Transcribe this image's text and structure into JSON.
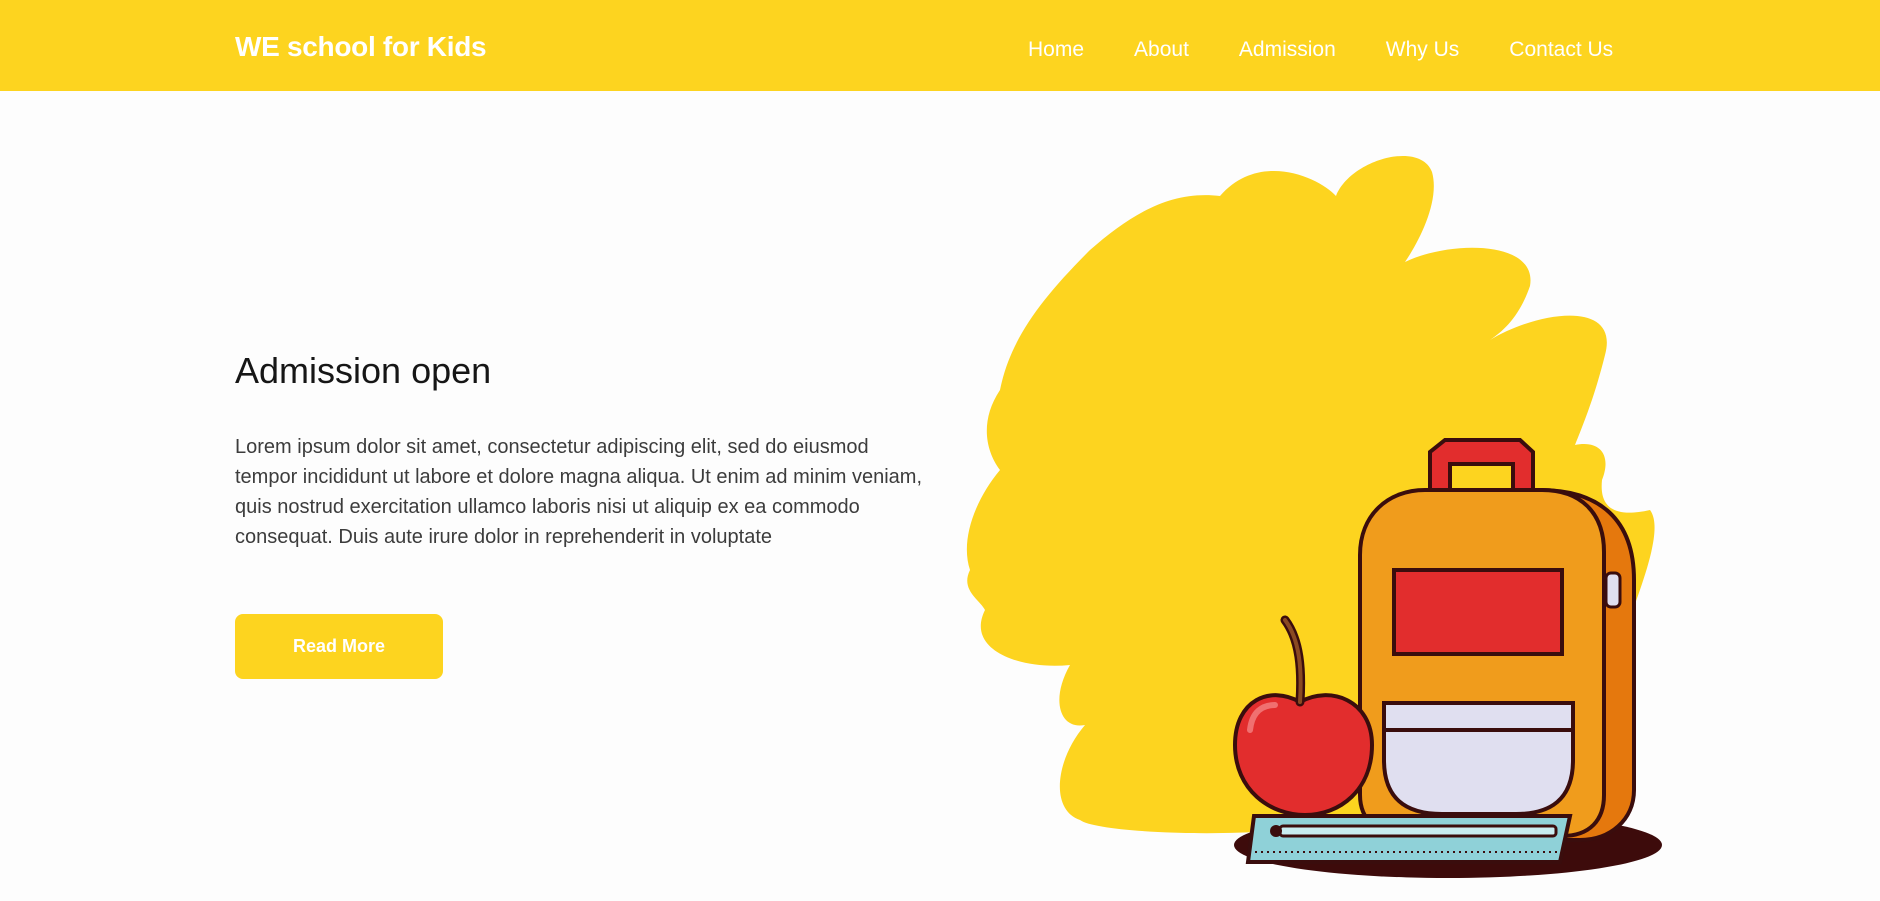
{
  "brand": {
    "name": "WE school for Kids"
  },
  "nav": {
    "items": [
      {
        "label": "Home"
      },
      {
        "label": "About"
      },
      {
        "label": "Admission"
      },
      {
        "label": "Why Us"
      },
      {
        "label": "Contact Us"
      }
    ]
  },
  "hero": {
    "title": "Admission open",
    "text": "Lorem ipsum dolor sit amet, consectetur adipiscing elit, sed do eiusmod tempor incididunt ut labore et dolore magna aliqua. Ut enim ad minim veniam, quis nostrud exercitation ullamco laboris nisi ut aliquip ex ea commodo consequat. Duis aute irure dolor in reprehenderit in voluptate",
    "button_label": "Read More"
  },
  "illustration": {
    "icon": "backpack-apple-ruler-illustration"
  },
  "colors": {
    "accent": "#fdd41f",
    "text_dark": "#161616",
    "text_body": "#3c3c3c",
    "background": "#fdfdfd"
  }
}
